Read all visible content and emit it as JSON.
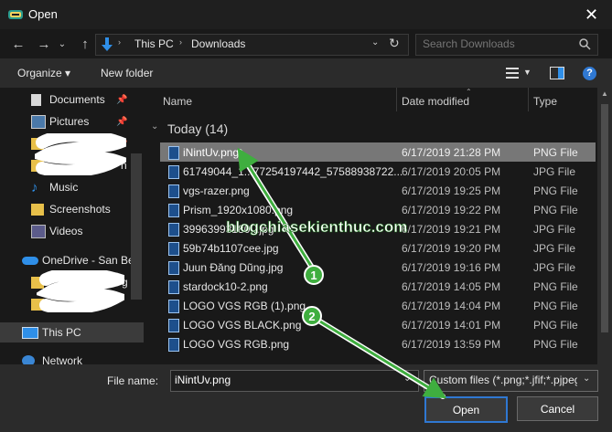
{
  "window": {
    "title": "Open"
  },
  "nav": {
    "path": [
      "This PC",
      "Downloads"
    ],
    "search_placeholder": "Search Downloads"
  },
  "toolbar": {
    "organize_label": "Organize ▾",
    "new_folder_label": "New folder"
  },
  "sidebar": {
    "items": [
      {
        "label": "Documents",
        "icon": "documents-icon",
        "pinned": true
      },
      {
        "label": "Pictures",
        "icon": "pictures-icon",
        "pinned": true
      },
      {
        "label": "",
        "icon": "folder-icon",
        "pinned": true
      },
      {
        "label": "n",
        "icon": "folder-icon",
        "pinned": false
      },
      {
        "label": "Music",
        "icon": "music-icon",
        "pinned": false
      },
      {
        "label": "Screenshots",
        "icon": "folder-icon",
        "pinned": false
      },
      {
        "label": "Videos",
        "icon": "videos-icon",
        "pinned": false
      },
      {
        "label": "OneDrive - San Be",
        "icon": "onedrive-icon",
        "pinned": false
      },
      {
        "label": "g",
        "icon": "folder-icon",
        "pinned": false
      },
      {
        "label": "w",
        "icon": "folder-icon",
        "pinned": false
      },
      {
        "label": "This PC",
        "icon": "this-pc-icon",
        "pinned": false,
        "selected": true
      },
      {
        "label": "Network",
        "icon": "network-icon",
        "pinned": false
      }
    ]
  },
  "filelist": {
    "columns": {
      "name": "Name",
      "date": "Date modified",
      "type": "Type"
    },
    "group_label": "Today (14)",
    "files": [
      {
        "name": "iNintUv.png",
        "date": "6/17/2019 21:28 PM",
        "type": "PNG File",
        "selected": true
      },
      {
        "name": "61749044_1...7725419744​2_57588938722...",
        "date": "6/17/2019 20:05 PM",
        "type": "JPG File"
      },
      {
        "name": "vgs-razer.png",
        "date": "6/17/2019 19:25 PM",
        "type": "PNG File"
      },
      {
        "name": "Prism_1920x1080.png",
        "date": "6/17/2019 19:22 PM",
        "type": "PNG File"
      },
      {
        "name": "39963993180...jpg",
        "date": "6/17/2019 19:21 PM",
        "type": "JPG File"
      },
      {
        "name": "59b74b1107cee.jpg",
        "date": "6/17/2019 19:20 PM",
        "type": "JPG File"
      },
      {
        "name": "Juun Đăng Dũng.jpg",
        "date": "6/17/2019 19:16 PM",
        "type": "JPG File"
      },
      {
        "name": "stardock10-2.png",
        "date": "6/17/2019 14:05 PM",
        "type": "PNG File"
      },
      {
        "name": "LOGO VGS RGB (1).png",
        "date": "6/17/2019 14:04 PM",
        "type": "PNG File"
      },
      {
        "name": "LOGO VGS BLACK.png",
        "date": "6/17/2019 14:01 PM",
        "type": "PNG File"
      },
      {
        "name": "LOGO VGS RGB.png",
        "date": "6/17/2019 13:59 PM",
        "type": "PNG File"
      }
    ]
  },
  "bottom": {
    "filename_label": "File name:",
    "filename_value": "iNintUv.png",
    "filetype_value": "Custom files (*.png;*.jfif;*.pjpeg",
    "open_label": "Open",
    "cancel_label": "Cancel"
  },
  "overlay": {
    "watermark": "blogchiasekienthuc.com",
    "step1": "1",
    "step2": "2",
    "arrow_color": "#3fae3f"
  }
}
